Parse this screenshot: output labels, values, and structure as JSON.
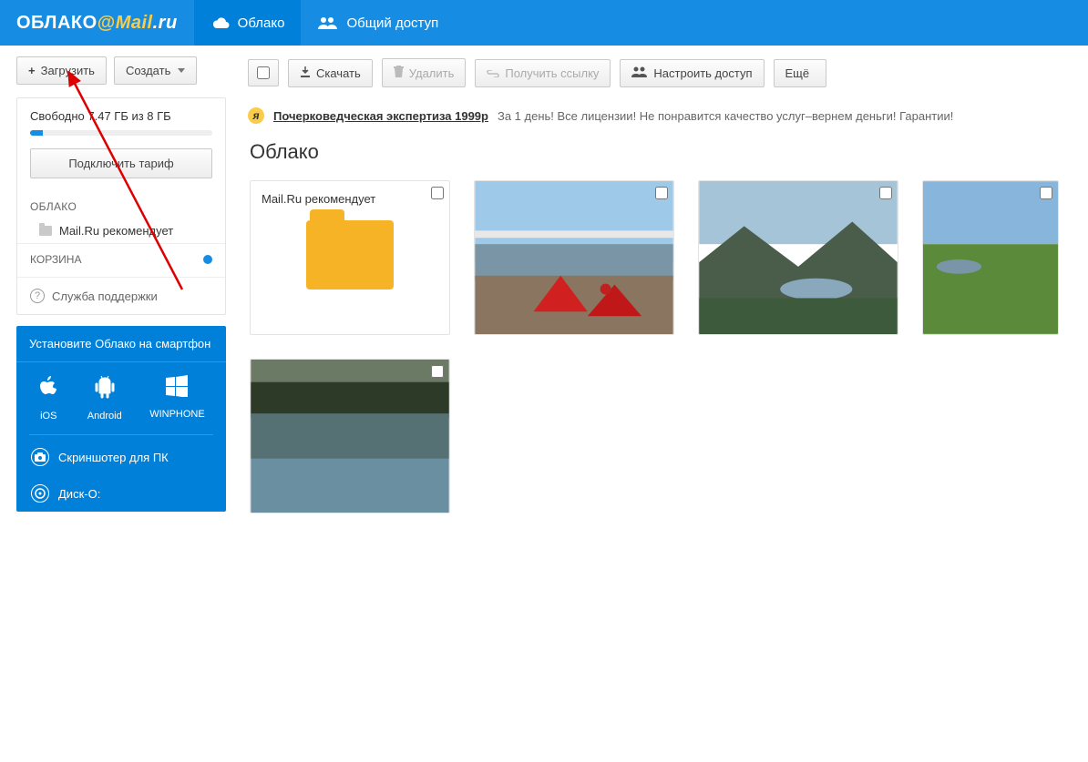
{
  "header": {
    "logo": {
      "cloud": "ОБЛАКО",
      "mail": "Mail",
      "ru": ".ru"
    },
    "tabs": [
      {
        "label": "Облако",
        "active": true
      },
      {
        "label": "Общий доступ",
        "active": false
      }
    ]
  },
  "sidebar": {
    "upload_btn": "Загрузить",
    "create_btn": "Создать",
    "storage_text": "Свободно 7.47 ГБ из 8 ГБ",
    "storage_used_pct": 7,
    "plan_btn": "Подключить тариф",
    "cloud_section": "ОБЛАКО",
    "tree_item": "Mail.Ru рекомендует",
    "trash_section": "КОРЗИНА",
    "support": "Служба поддержки",
    "promo": {
      "title": "Установите Облако на смартфон",
      "apps": [
        {
          "name": "iOS"
        },
        {
          "name": "Android"
        },
        {
          "name": "WINPHONE"
        }
      ],
      "screenshoter": "Скриншотер для ПК",
      "disko": "Диск-О:"
    }
  },
  "toolbar": {
    "download": "Скачать",
    "delete": "Удалить",
    "get_link": "Получить ссылку",
    "share": "Настроить доступ",
    "more": "Ещё"
  },
  "ad": {
    "link": "Почерковедческая экспертиза 1999р",
    "text": "За 1 день! Все лицензии! Не понравится качество услуг–вернем деньги! Гарантии!"
  },
  "page_title": "Облако",
  "folder_card_label": "Mail.Ru рекомендует"
}
